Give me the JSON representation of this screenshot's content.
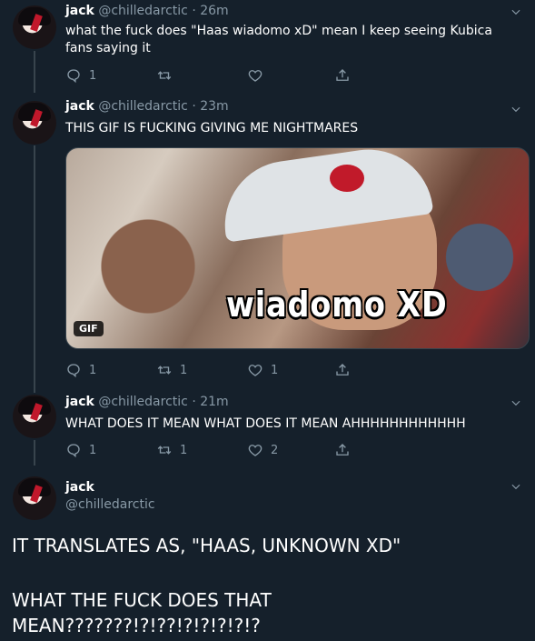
{
  "tweets": [
    {
      "name": "jack",
      "handle": "@chilledarctic",
      "time": "26m",
      "text": "what the fuck does \"Haas wiadomo xD\" mean I keep seeing Kubica fans saying it",
      "text_line2": "saying it",
      "replies": "1",
      "retweets": "",
      "likes": ""
    },
    {
      "name": "jack",
      "handle": "@chilledarctic",
      "time": "23m",
      "text": "THIS GIF IS FUCKING GIVING ME NIGHTMARES",
      "replies": "1",
      "retweets": "1",
      "likes": "1",
      "media": {
        "caption": "wiadomo XD",
        "badge": "GIF"
      }
    },
    {
      "name": "jack",
      "handle": "@chilledarctic",
      "time": "21m",
      "text": "WHAT DOES IT MEAN WHAT DOES IT MEAN AHHHHHHHHHHHH",
      "replies": "1",
      "retweets": "1",
      "likes": "2"
    }
  ],
  "main_tweet": {
    "name": "jack",
    "handle": "@chilledarctic",
    "line1": "IT TRANSLATES AS, \"HAAS, UNKNOWN XD\"",
    "line2": "WHAT THE FUCK DOES THAT",
    "line3": "MEAN???????!?!??!?!?!?!?!?"
  },
  "meta_separator": "·",
  "icons": [
    "reply-icon",
    "retweet-icon",
    "like-icon",
    "share-icon",
    "caret-down-icon"
  ]
}
